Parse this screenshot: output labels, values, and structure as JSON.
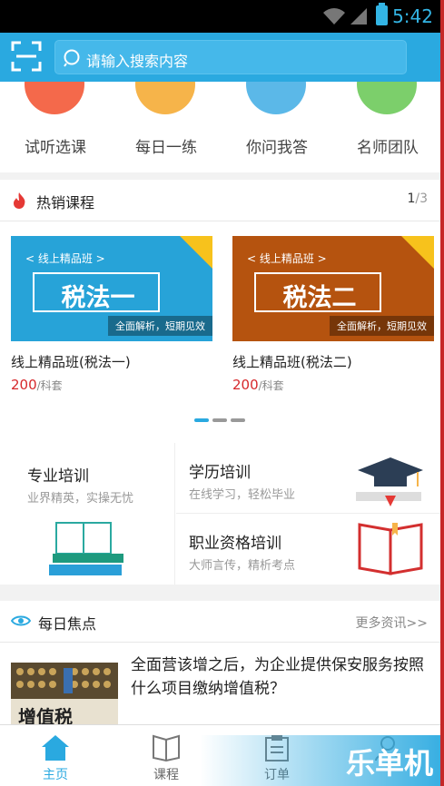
{
  "status": {
    "time": "5:42"
  },
  "search": {
    "placeholder": "请输入搜索内容"
  },
  "categories": [
    {
      "label": "试听选课",
      "color": "#f4694b"
    },
    {
      "label": "每日一练",
      "color": "#f6b44a"
    },
    {
      "label": "你问我答",
      "color": "#5bb8e8"
    },
    {
      "label": "名师团队",
      "color": "#7ccf6b"
    }
  ],
  "hot": {
    "title": "热销课程",
    "page_current": "1",
    "page_total": "/3",
    "courses": [
      {
        "banner_top": "< 线上精品班 >",
        "banner_main": "税法一",
        "banner_sub": "全面解析，短期见效",
        "name": "线上精品班(税法一)",
        "price": "200",
        "unit": "/科套",
        "color": "#27a3d8"
      },
      {
        "banner_top": "< 线上精品班 >",
        "banner_main": "税法二",
        "banner_sub": "全面解析，短期见效",
        "name": "线上精品班(税法二)",
        "price": "200",
        "unit": "/科套",
        "color": "#b5530f"
      }
    ]
  },
  "training": {
    "left": {
      "title": "专业培训",
      "sub": "业界精英，实操无忧"
    },
    "r1": {
      "title": "学历培训",
      "sub": "在线学习，轻松毕业"
    },
    "r2": {
      "title": "职业资格培训",
      "sub": "大师言传，精析考点"
    }
  },
  "focus": {
    "title": "每日焦点",
    "more": "更多资讯>>",
    "news_title": "全面营该增之后，为企业提供保安服务按照什么项目缴纳增值税？",
    "img_text": "增值税"
  },
  "tabs": [
    {
      "label": "主页"
    },
    {
      "label": "课程"
    },
    {
      "label": "订单"
    },
    {
      "label": ""
    }
  ],
  "watermark": "乐单机"
}
